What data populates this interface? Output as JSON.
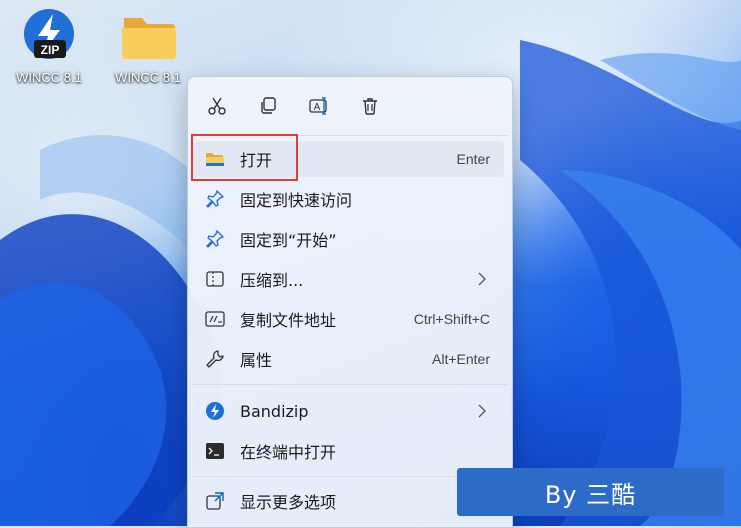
{
  "desktop": {
    "icons": [
      {
        "label": "WINCC 8.1",
        "icon": "zip-archive-icon",
        "badge": "ZIP"
      },
      {
        "label": "WINCC 8.1",
        "icon": "folder-icon"
      }
    ]
  },
  "context_menu": {
    "toolbar": [
      {
        "name": "cut",
        "icon": "scissors-icon"
      },
      {
        "name": "copy",
        "icon": "copy-icon"
      },
      {
        "name": "rename",
        "icon": "rename-icon"
      },
      {
        "name": "delete",
        "icon": "trash-icon"
      }
    ],
    "items": [
      {
        "label": "打开",
        "shortcut": "Enter",
        "icon": "folder-icon"
      },
      {
        "label": "固定到快速访问",
        "shortcut": "",
        "icon": "pin-icon"
      },
      {
        "label": "固定到“开始”",
        "shortcut": "",
        "icon": "pin-icon"
      },
      {
        "label": "压缩到...",
        "shortcut": "",
        "icon": "compress-icon"
      },
      {
        "label": "复制文件地址",
        "shortcut": "Ctrl+Shift+C",
        "icon": "path-icon"
      },
      {
        "label": "属性",
        "shortcut": "Alt+Enter",
        "icon": "wrench-icon"
      },
      {
        "label": "Bandizip",
        "shortcut": "",
        "icon": "bandizip-icon"
      },
      {
        "label": "在终端中打开",
        "shortcut": "",
        "icon": "terminal-icon"
      },
      {
        "label": "显示更多选项",
        "shortcut": "",
        "icon": "more-options-icon"
      }
    ]
  },
  "watermark": {
    "text": "By 三酷"
  },
  "colors": {
    "highlight_border": "#e23b3b",
    "badge_bg": "#2d6bc9",
    "accent": "#0067c0"
  }
}
